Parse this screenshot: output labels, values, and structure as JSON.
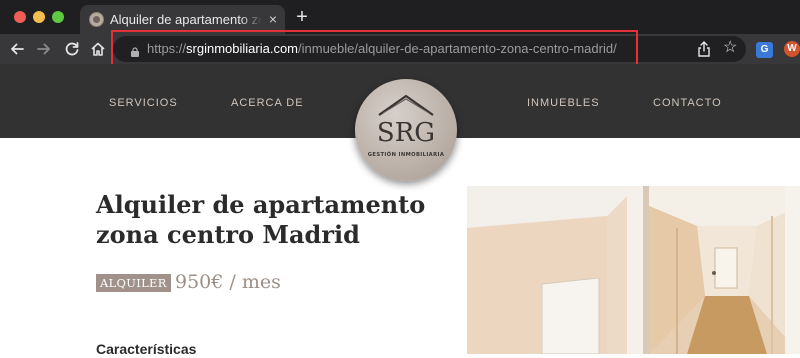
{
  "browser": {
    "tab_title": "Alquiler de apartamento zona c",
    "tab_close": "×",
    "new_tab": "+",
    "url_scheme": "https://",
    "url_domain": "srginmobiliaria.com",
    "url_path": "/inmueble/alquiler-de-apartamento-zona-centro-madrid/",
    "extension_1_label": "G",
    "extension_2_label": "W"
  },
  "site_nav": {
    "items": [
      {
        "label": "SERVICIOS"
      },
      {
        "label": "ACERCA DE"
      },
      {
        "label": "INMUEBLES"
      },
      {
        "label": "CONTACTO"
      }
    ]
  },
  "logo": {
    "monogram": "SRG",
    "tagline": "GESTIÓN INMOBILIARIA"
  },
  "property": {
    "title": "Alquiler de apartamento zona centro Madrid",
    "badge": "ALQUILER",
    "price": "950€ / mes",
    "features_heading": "Características"
  },
  "colors": {
    "header_bg": "#333232",
    "accent_taupe": "#a0928a",
    "annotation_red": "#e3313a"
  },
  "icons": [
    "back-arrow-icon",
    "forward-arrow-icon",
    "reload-icon",
    "home-icon",
    "lock-icon",
    "share-icon",
    "star-icon",
    "close-icon",
    "plus-icon"
  ]
}
